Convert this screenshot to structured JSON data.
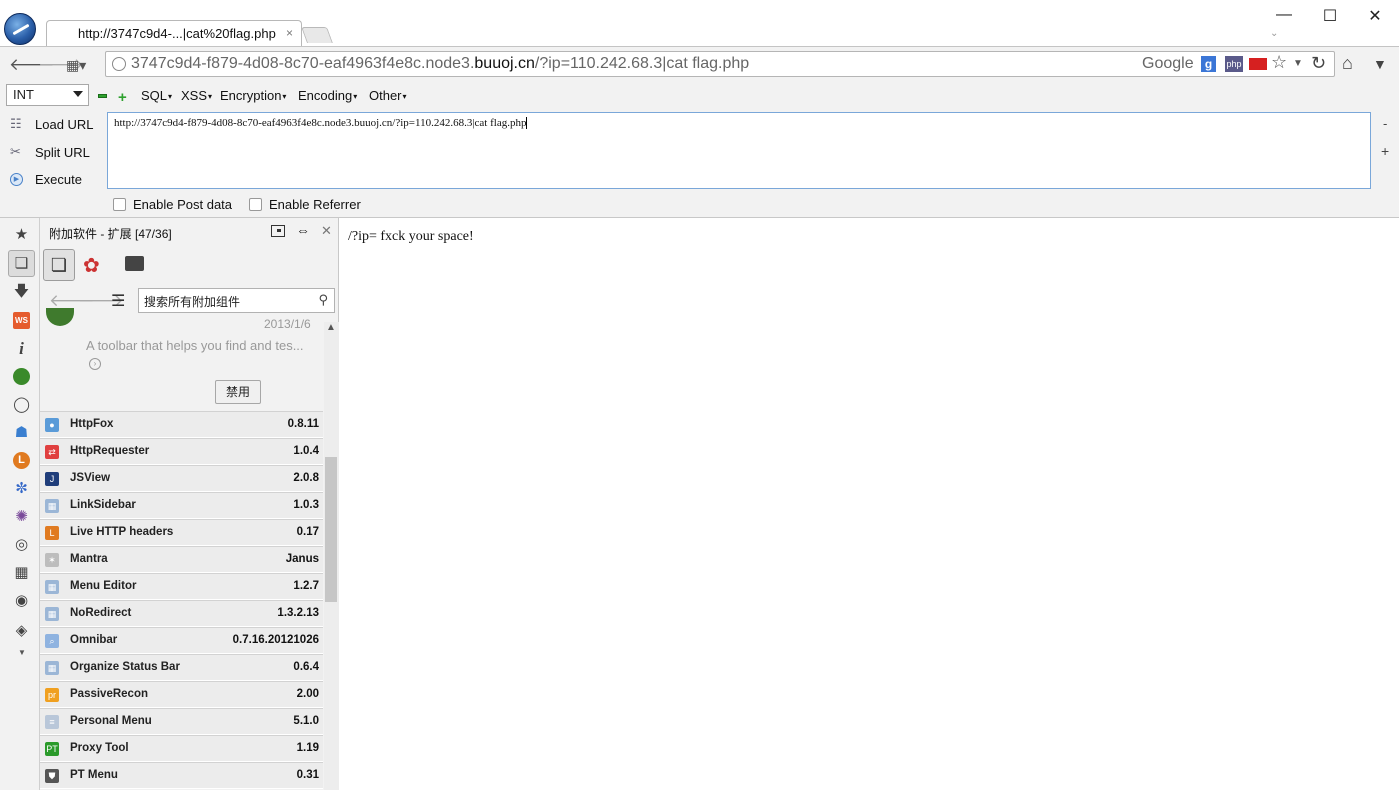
{
  "tab": {
    "title": "http://3747c9d4-...|cat%20flag.php",
    "close": "×"
  },
  "window": {
    "min": "—",
    "max": "☐",
    "close": "✕"
  },
  "address": {
    "prefix": "3747c9d4-f879-4d08-8c70-eaf4963f4e8c.node3.",
    "domain": "buuoj.cn",
    "suffix": "/?ip=110.242.68.3|cat flag.php",
    "search_engine": "Google",
    "g_badge": "g",
    "php_badge": "php"
  },
  "hackbar": {
    "type_select": "INT",
    "menus": {
      "sql": "SQL",
      "xss": "XSS",
      "encryption": "Encryption",
      "encoding": "Encoding",
      "other": "Other"
    },
    "actions": {
      "load": "Load URL",
      "split": "Split URL",
      "execute": "Execute"
    },
    "url_value": "http://3747c9d4-f879-4d08-8c70-eaf4963f4e8c.node3.buuoj.cn/?ip=110.242.68.3|cat flag.php",
    "side_minus": "-",
    "side_plus": "+",
    "enable_post": "Enable Post data",
    "enable_referrer": "Enable Referrer"
  },
  "sidebar": {
    "title": "附加软件 - 扩展 [47/36]",
    "search_placeholder": "搜索所有附加组件",
    "expanded": {
      "date": "2013/1/6",
      "description": "A toolbar that helps you find and tes...",
      "disable_label": "禁用"
    },
    "addons": [
      {
        "name": "HttpFox",
        "version": "0.8.11",
        "icon_color": "#5a9bd8",
        "icon_glyph": "●"
      },
      {
        "name": "HttpRequester",
        "version": "1.0.4",
        "icon_color": "#e04040",
        "icon_glyph": "⇄"
      },
      {
        "name": "JSView",
        "version": "2.0.8",
        "icon_color": "#1f3d7a",
        "icon_glyph": "J"
      },
      {
        "name": "LinkSidebar",
        "version": "1.0.3",
        "icon_color": "#9bb6d6",
        "icon_glyph": "▦"
      },
      {
        "name": "Live HTTP headers",
        "version": "0.17",
        "icon_color": "#e07a20",
        "icon_glyph": "L"
      },
      {
        "name": "Mantra",
        "version": "Janus",
        "icon_color": "#bdbdbd",
        "icon_glyph": "✶"
      },
      {
        "name": "Menu Editor",
        "version": "1.2.7",
        "icon_color": "#9bb6d6",
        "icon_glyph": "▦"
      },
      {
        "name": "NoRedirect",
        "version": "1.3.2.13",
        "icon_color": "#9bb6d6",
        "icon_glyph": "▦"
      },
      {
        "name": "Omnibar",
        "version": "0.7.16.20121026",
        "icon_color": "#8fb3e0",
        "icon_glyph": "⌕"
      },
      {
        "name": "Organize Status Bar",
        "version": "0.6.4",
        "icon_color": "#9bb6d6",
        "icon_glyph": "▦"
      },
      {
        "name": "PassiveRecon",
        "version": "2.00",
        "icon_color": "#f0a020",
        "icon_glyph": "pr"
      },
      {
        "name": "Personal Menu",
        "version": "5.1.0",
        "icon_color": "#b9c7d9",
        "icon_glyph": "≡"
      },
      {
        "name": "Proxy Tool",
        "version": "1.19",
        "icon_color": "#2a9a2a",
        "icon_glyph": "PT"
      },
      {
        "name": "PT Menu",
        "version": "0.31",
        "icon_color": "#555555",
        "icon_glyph": "⛊"
      }
    ]
  },
  "content": {
    "text": "/?ip= fxck your space!"
  },
  "icons": {
    "column": [
      "star-icon",
      "addons-icon",
      "download-icon",
      "ws-icon",
      "info-icon",
      "green-globe-icon",
      "glasses-icon",
      "inspector-icon",
      "firebug-icon",
      "spiral-icon",
      "virus-icon",
      "palette-icon",
      "grid-icon",
      "earth-icon",
      "tag-icon"
    ]
  }
}
